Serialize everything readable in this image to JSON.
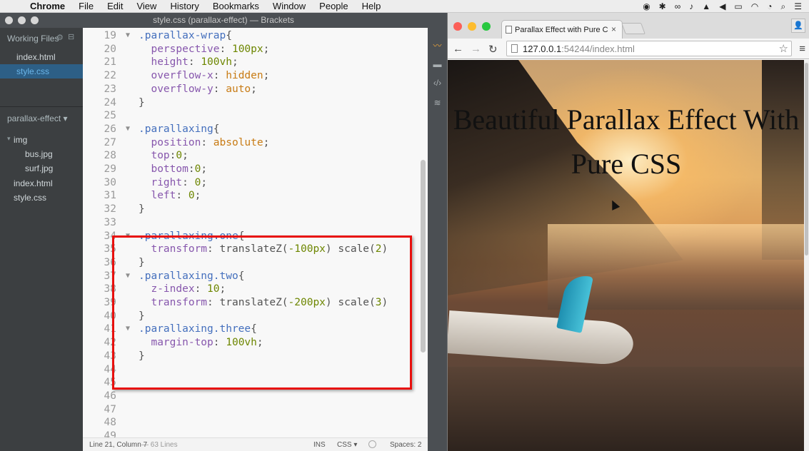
{
  "menubar": {
    "apple": "",
    "items": [
      "Chrome",
      "File",
      "Edit",
      "View",
      "History",
      "Bookmarks",
      "Window",
      "People",
      "Help"
    ]
  },
  "brackets": {
    "title": "style.css (parallax-effect) — Brackets",
    "sidebar": {
      "working_files_title": "Working Files",
      "working_files": [
        "index.html",
        "style.css"
      ],
      "project_title": "parallax-effect",
      "tree": [
        {
          "label": "img",
          "indent": 1
        },
        {
          "label": "bus.jpg",
          "indent": 2
        },
        {
          "label": "surf.jpg",
          "indent": 2
        },
        {
          "label": "index.html",
          "indent": 1
        },
        {
          "label": "style.css",
          "indent": 1
        }
      ]
    },
    "code_lines": [
      {
        "n": "19",
        "fold": "▼",
        "parts": [
          [
            ".parallax-wrap",
            "sel"
          ],
          [
            "{",
            "punc"
          ]
        ]
      },
      {
        "n": "20",
        "fold": "",
        "parts": [
          [
            "  perspective",
            "prop"
          ],
          [
            ": ",
            "punc"
          ],
          [
            "100px",
            "num"
          ],
          [
            ";",
            "punc"
          ]
        ]
      },
      {
        "n": "21",
        "fold": "",
        "parts": [
          [
            "  height",
            "prop"
          ],
          [
            ": ",
            "punc"
          ],
          [
            "100vh",
            "num"
          ],
          [
            ";",
            "punc"
          ]
        ]
      },
      {
        "n": "22",
        "fold": "",
        "parts": [
          [
            "  overflow-x",
            "prop"
          ],
          [
            ": ",
            "punc"
          ],
          [
            "hidden",
            "val"
          ],
          [
            ";",
            "punc"
          ]
        ]
      },
      {
        "n": "23",
        "fold": "",
        "parts": [
          [
            "  overflow-y",
            "prop"
          ],
          [
            ": ",
            "punc"
          ],
          [
            "auto",
            "val"
          ],
          [
            ";",
            "punc"
          ]
        ]
      },
      {
        "n": "24",
        "fold": "",
        "parts": [
          [
            "}",
            "punc"
          ]
        ]
      },
      {
        "n": "25",
        "fold": "",
        "parts": []
      },
      {
        "n": "26",
        "fold": "▼",
        "parts": [
          [
            ".parallaxing",
            "sel"
          ],
          [
            "{",
            "punc"
          ]
        ]
      },
      {
        "n": "27",
        "fold": "",
        "parts": [
          [
            "  position",
            "prop"
          ],
          [
            ": ",
            "punc"
          ],
          [
            "absolute",
            "val"
          ],
          [
            ";",
            "punc"
          ]
        ]
      },
      {
        "n": "28",
        "fold": "",
        "parts": [
          [
            "  top",
            "prop"
          ],
          [
            ":",
            "punc"
          ],
          [
            "0",
            "num"
          ],
          [
            ";",
            "punc"
          ]
        ]
      },
      {
        "n": "29",
        "fold": "",
        "parts": [
          [
            "  bottom",
            "prop"
          ],
          [
            ":",
            "punc"
          ],
          [
            "0",
            "num"
          ],
          [
            ";",
            "punc"
          ]
        ]
      },
      {
        "n": "30",
        "fold": "",
        "parts": [
          [
            "  right",
            "prop"
          ],
          [
            ": ",
            "punc"
          ],
          [
            "0",
            "num"
          ],
          [
            ";",
            "punc"
          ]
        ]
      },
      {
        "n": "31",
        "fold": "",
        "parts": [
          [
            "  left",
            "prop"
          ],
          [
            ": ",
            "punc"
          ],
          [
            "0",
            "num"
          ],
          [
            ";",
            "punc"
          ]
        ]
      },
      {
        "n": "32",
        "fold": "",
        "parts": [
          [
            "}",
            "punc"
          ]
        ]
      },
      {
        "n": "33",
        "fold": "",
        "parts": []
      },
      {
        "n": "34",
        "fold": "▼",
        "parts": [
          [
            ".parallaxing.one",
            "sel"
          ],
          [
            "{",
            "punc"
          ]
        ]
      },
      {
        "n": "35",
        "fold": "",
        "parts": [
          [
            "  transform",
            "prop"
          ],
          [
            ": ",
            "punc"
          ],
          [
            "translateZ(",
            "punc"
          ],
          [
            "-100px",
            "num"
          ],
          [
            ") scale(",
            "punc"
          ],
          [
            "2",
            "num"
          ],
          [
            ")",
            "punc"
          ]
        ]
      },
      {
        "n": "36",
        "fold": "",
        "parts": [
          [
            "}",
            "punc"
          ]
        ]
      },
      {
        "n": "37",
        "fold": "▼",
        "parts": [
          [
            ".parallaxing.two",
            "sel"
          ],
          [
            "{",
            "punc"
          ]
        ]
      },
      {
        "n": "38",
        "fold": "",
        "parts": [
          [
            "  z-index",
            "prop"
          ],
          [
            ": ",
            "punc"
          ],
          [
            "10",
            "num"
          ],
          [
            ";",
            "punc"
          ]
        ]
      },
      {
        "n": "39",
        "fold": "",
        "parts": [
          [
            "  transform",
            "prop"
          ],
          [
            ": ",
            "punc"
          ],
          [
            "translateZ(",
            "punc"
          ],
          [
            "-200px",
            "num"
          ],
          [
            ") scale(",
            "punc"
          ],
          [
            "3",
            "num"
          ],
          [
            ")",
            "punc"
          ]
        ]
      },
      {
        "n": "40",
        "fold": "",
        "parts": [
          [
            "}",
            "punc"
          ]
        ]
      },
      {
        "n": "41",
        "fold": "▼",
        "parts": [
          [
            ".parallaxing.three",
            "sel"
          ],
          [
            "{",
            "punc"
          ]
        ]
      },
      {
        "n": "42",
        "fold": "",
        "parts": [
          [
            "  margin-top",
            "prop"
          ],
          [
            ": ",
            "punc"
          ],
          [
            "100vh",
            "num"
          ],
          [
            ";",
            "punc"
          ]
        ]
      },
      {
        "n": "43",
        "fold": "",
        "parts": [
          [
            "}",
            "punc"
          ]
        ]
      },
      {
        "n": "44",
        "fold": "",
        "parts": []
      },
      {
        "n": "45",
        "fold": "",
        "parts": []
      },
      {
        "n": "46",
        "fold": "",
        "parts": []
      },
      {
        "n": "47",
        "fold": "",
        "parts": []
      },
      {
        "n": "48",
        "fold": "",
        "parts": []
      },
      {
        "n": "49",
        "fold": "",
        "parts": []
      }
    ],
    "status": {
      "cursor": "Line 21, Column 7",
      "lines": "— 63 Lines",
      "mode": "INS",
      "language": "CSS ▾",
      "spaces": "Spaces: 2"
    }
  },
  "chrome": {
    "tab_title": "Parallax Effect with Pure C",
    "url_host": "127.0.0.1",
    "url_rest": ":54244/index.html",
    "hero_title": "Beautiful Parallax Effect With Pure CSS"
  }
}
